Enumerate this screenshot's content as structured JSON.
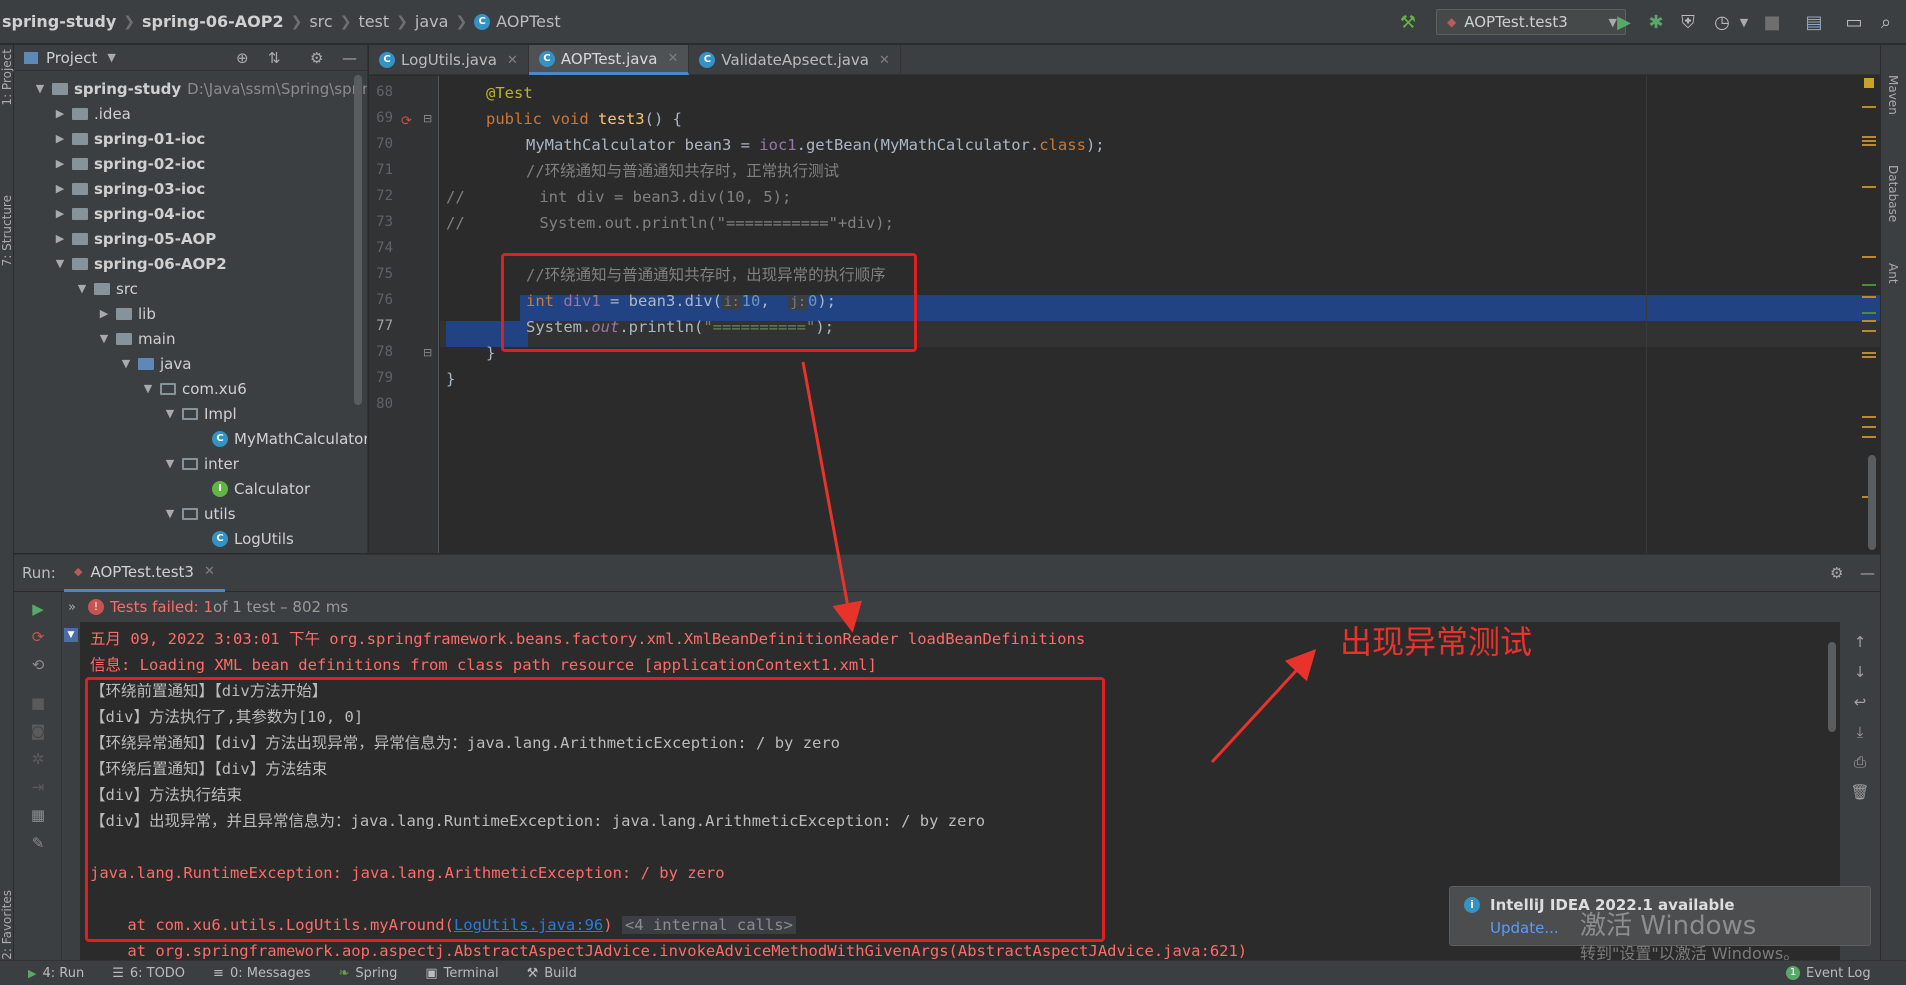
{
  "breadcrumbs": {
    "project": "spring-study",
    "module": "spring-06-AOP2",
    "src": "src",
    "test": "test",
    "java": "java",
    "file": "AOPTest"
  },
  "run_config": "AOPTest.test3",
  "left_strip": {
    "project": "1: Project",
    "structure": "7: Structure",
    "favorites": "2: Favorites"
  },
  "right_strip": {
    "maven": "Maven",
    "database": "Database",
    "ant": "Ant"
  },
  "project_panel": {
    "title": "Project",
    "tree": [
      {
        "label": "spring-study",
        "extra": "D:\\Java\\ssm\\Spring\\spring-s"
      },
      {
        "label": ".idea"
      },
      {
        "label": "spring-01-ioc"
      },
      {
        "label": "spring-02-ioc"
      },
      {
        "label": "spring-03-ioc"
      },
      {
        "label": "spring-04-ioc"
      },
      {
        "label": "spring-05-AOP"
      },
      {
        "label": "spring-06-AOP2"
      },
      {
        "label": "src"
      },
      {
        "label": "lib"
      },
      {
        "label": "main"
      },
      {
        "label": "java"
      },
      {
        "label": "com.xu6"
      },
      {
        "label": "Impl"
      },
      {
        "label": "MyMathCalculator"
      },
      {
        "label": "inter"
      },
      {
        "label": "Calculator"
      },
      {
        "label": "utils"
      },
      {
        "label": "LogUtils"
      }
    ]
  },
  "tabs": [
    {
      "label": "LogUtils.java"
    },
    {
      "label": "AOPTest.java"
    },
    {
      "label": "ValidateApsect.java"
    }
  ],
  "editor": {
    "line_numbers": [
      "68",
      "69",
      "70",
      "71",
      "72",
      "73",
      "74",
      "75",
      "76",
      "77",
      "78",
      "79",
      "80"
    ],
    "l68": "@Test",
    "l69_kw": "public void ",
    "l69_fn": "test3",
    "l69_rest": "() {",
    "l70_a": "MyMathCalculator bean3 = ",
    "l70_b": "ioc1",
    "l70_c": ".getBean(MyMathCalculator.",
    "l70_d": "class",
    "l70_e": ");",
    "l71": "//环绕通知与普通通知共存时，正常执行测试",
    "l72": "//        int div = bean3.div(10, 5);",
    "l73": "//        System.out.println(\"===========\"+div);",
    "l75": "//环绕通知与普通通知共存时，出现异常的执行顺序",
    "l76_kw": "int ",
    "l76_var": "div1",
    "l76_a": " = bean3.div(",
    "l76_h1": "i:",
    "l76_v1": "10",
    "l76_sep": ",  ",
    "l76_h2": "j:",
    "l76_v2": "0",
    "l76_end": ");",
    "l77_a": "System.",
    "l77_out": "out",
    "l77_b": ".println(",
    "l77_str": "\"==========\"",
    "l77_c": ");",
    "l78": "}",
    "l79": "}"
  },
  "run_panel": {
    "label": "Run:",
    "tab": "AOPTest.test3",
    "status_failed": "Tests failed: 1",
    "status_rest": " of 1 test – 802 ms"
  },
  "console": {
    "lines": [
      "五月 09, 2022 3:03:01 下午 org.springframework.beans.factory.xml.XmlBeanDefinitionReader loadBeanDefinitions",
      "信息: Loading XML bean definitions from class path resource [applicationContext1.xml]",
      "【环绕前置通知】【div方法开始】",
      "【div】方法执行了,其参数为[10, 0]",
      "【环绕异常通知】【div】方法出现异常，异常信息为：java.lang.ArithmeticException: / by zero",
      "【环绕后置通知】【div】方法结束",
      "【div】方法执行结束",
      "【div】出现异常，并且异常信息为：java.lang.RuntimeException: java.lang.ArithmeticException: / by zero",
      "java.lang.RuntimeException: java.lang.ArithmeticException: / by zero"
    ],
    "at1_pre": "    at com.xu6.utils.LogUtils.myAround(",
    "at1_link": "LogUtils.java:96",
    "at1_post": ")",
    "at1_internal": "<4 internal calls>",
    "at2": "    at org.springframework.aop.aspectj.AbstractAspectJAdvice.invokeAdviceMethodWithGivenArgs(AbstractAspectJAdvice.java:621)"
  },
  "annotation": "出现异常测试",
  "notification": {
    "title": "IntelliJ IDEA 2022.1 available",
    "link": "Update..."
  },
  "watermark": {
    "line1": "激活 Windows",
    "line2": "转到\"设置\"以激活 Windows。"
  },
  "statusbar": {
    "run": "4: Run",
    "todo": "6: TODO",
    "messages": "0: Messages",
    "spring": "Spring",
    "terminal": "Terminal",
    "build": "Build",
    "eventlog": "Event Log",
    "eventlog_count": "1"
  },
  "colors": {
    "annotation_red": "#e02020",
    "accent_blue": "#4a88c7",
    "error_red": "#ff6b68"
  }
}
